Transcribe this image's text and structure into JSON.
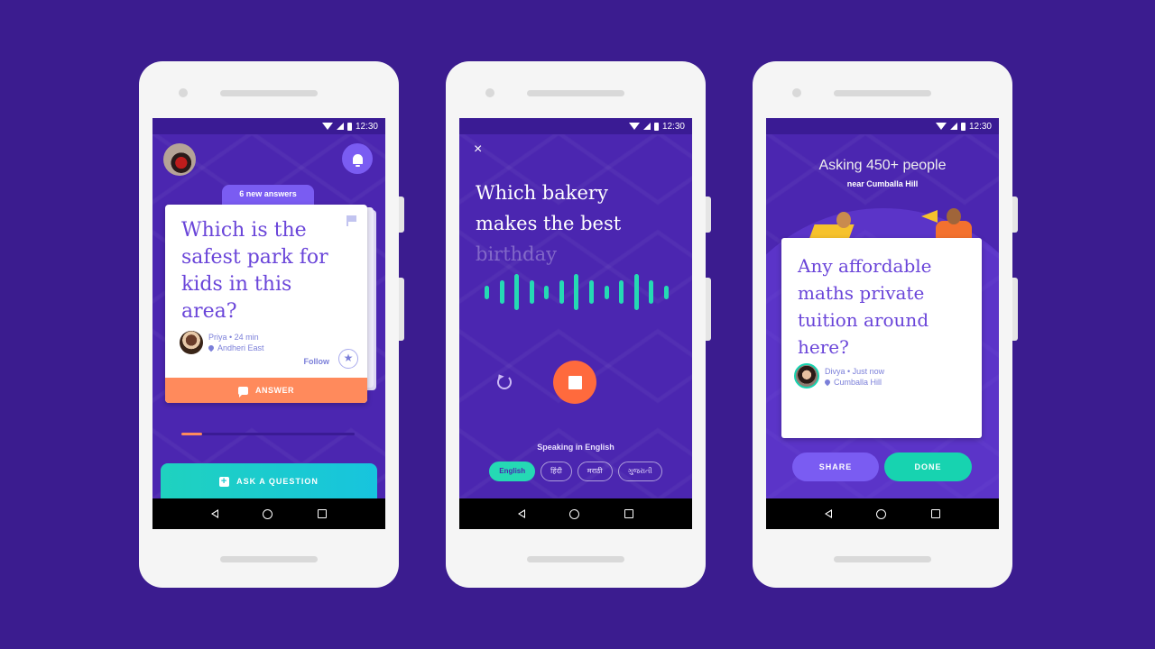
{
  "status_bar": {
    "time": "12:30"
  },
  "phone1": {
    "new_answers_label": "6 new answers",
    "question": "Which is the safest park for kids in this area?",
    "author": "Priya • 24 min",
    "location": "Andheri East",
    "follow_label": "Follow",
    "answer_label": "ANSWER",
    "progress_percent": 12,
    "ask_label": "ASK A QUESTION"
  },
  "phone2": {
    "close_label": "×",
    "question_main": "Which bakery makes the best",
    "question_partial": "birthday",
    "waveform_levels": [
      0.35,
      0.6,
      0.9,
      0.6,
      0.35,
      0.6,
      0.9,
      0.6,
      0.35,
      0.6,
      0.9,
      0.6,
      0.35
    ],
    "speaking_label": "Speaking in English",
    "languages": [
      {
        "label": "English",
        "active": true
      },
      {
        "label": "हिंदी",
        "active": false
      },
      {
        "label": "मराठी",
        "active": false
      },
      {
        "label": "ગુજરાતી",
        "active": false
      }
    ]
  },
  "phone3": {
    "asking_label": "Asking 450+ people",
    "near_label": "near Cumballa Hill",
    "question": "Any affordable maths private tuition around here?",
    "author": "Divya • Just now",
    "location": "Cumballa Hill",
    "share_label": "SHARE",
    "done_label": "DONE"
  },
  "colors": {
    "background": "#3b1c8f",
    "screen": "#4b26b0",
    "accent_teal": "#25d9b4",
    "accent_orange": "#ff8a5c",
    "accent_purple": "#7a5cf2"
  }
}
